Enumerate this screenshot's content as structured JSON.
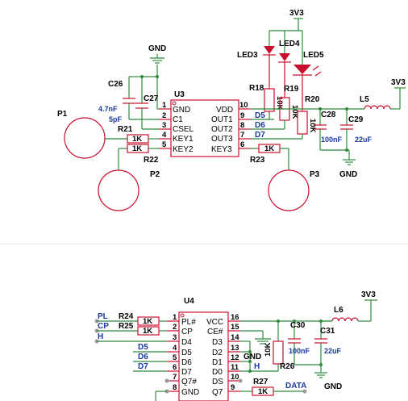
{
  "colors": {
    "wire": "#2e8b3e",
    "part": "#c8102e",
    "label": "#1a3a9c",
    "text": "#000000"
  },
  "top": {
    "power": {
      "net_3v3_top": "3V3",
      "net_3v3_right": "3V3",
      "gnd_top": "GND",
      "gnd_right": "GND"
    },
    "u3": {
      "ref": "U3",
      "left_pins": [
        {
          "num": "1",
          "name": "GND"
        },
        {
          "num": "2",
          "name": "C1"
        },
        {
          "num": "3",
          "name": "CSEL"
        },
        {
          "num": "4",
          "name": "KEY1"
        },
        {
          "num": "5",
          "name": "KEY2"
        }
      ],
      "right_pins": [
        {
          "num": "10",
          "name": "VDD"
        },
        {
          "num": "9",
          "name": "OUT1"
        },
        {
          "num": "8",
          "name": "OUT2"
        },
        {
          "num": "7",
          "name": "OUT3"
        },
        {
          "num": "6",
          "name": "KEY3"
        }
      ]
    },
    "caps": {
      "c26": {
        "ref": "C26",
        "value": "4.7nF"
      },
      "c27": {
        "ref": "C27",
        "value": "5pF"
      },
      "c28": {
        "ref": "C28",
        "value": "100nF"
      },
      "c29": {
        "ref": "C29",
        "value": "22uF"
      }
    },
    "resistors": {
      "r18": {
        "ref": "R18",
        "value": "10K"
      },
      "r19": {
        "ref": "R19",
        "value": "10K"
      },
      "r20": {
        "ref": "R20",
        "value": "10K"
      },
      "r21": {
        "ref": "R21",
        "value": "1K"
      },
      "r22": {
        "ref": "R22",
        "value": "1K"
      },
      "r23": {
        "ref": "R23",
        "value": "1K"
      }
    },
    "leds": {
      "led3": "LED3",
      "led4": "LED4",
      "led5": "LED5"
    },
    "inductor": "L5",
    "net_labels": {
      "d5": "D5",
      "d6": "D6",
      "d7": "D7"
    },
    "pads": {
      "p1": "P1",
      "p2": "P2",
      "p3": "P3"
    }
  },
  "bottom": {
    "power": {
      "net_3v3": "3V3",
      "gnd_mid": "GND",
      "gnd_right": "GND"
    },
    "u4": {
      "ref": "U4",
      "left_pins": [
        {
          "num": "1",
          "name": "PL#"
        },
        {
          "num": "2",
          "name": "CP"
        },
        {
          "num": "3",
          "name": "D4"
        },
        {
          "num": "4",
          "name": "D5"
        },
        {
          "num": "5",
          "name": "D6"
        },
        {
          "num": "6",
          "name": "D7"
        },
        {
          "num": "7",
          "name": "Q7#"
        },
        {
          "num": "8",
          "name": "GND"
        }
      ],
      "right_pins": [
        {
          "num": "16",
          "name": "VCC"
        },
        {
          "num": "15",
          "name": "CE#"
        },
        {
          "num": "14",
          "name": "D3"
        },
        {
          "num": "13",
          "name": "D2"
        },
        {
          "num": "12",
          "name": "D1"
        },
        {
          "num": "11",
          "name": "D0"
        },
        {
          "num": "10",
          "name": "DS"
        },
        {
          "num": "9",
          "name": "Q7"
        }
      ]
    },
    "resistors": {
      "r24": {
        "ref": "R24",
        "value": "1K"
      },
      "r25": {
        "ref": "R25",
        "value": "1K"
      },
      "r26": {
        "ref": "R26",
        "value": "10K"
      },
      "r27": {
        "ref": "R27",
        "value": "1K"
      }
    },
    "caps": {
      "c30": {
        "ref": "C30",
        "value": "100nF"
      },
      "c31": {
        "ref": "C31",
        "value": "22uF"
      }
    },
    "inductor": "L6",
    "net_labels": {
      "pl": "PL",
      "cp": "CP",
      "h_left": "H",
      "d5": "D5",
      "d6": "D6",
      "d7": "D7",
      "h_right": "H",
      "data": "DATA"
    }
  }
}
